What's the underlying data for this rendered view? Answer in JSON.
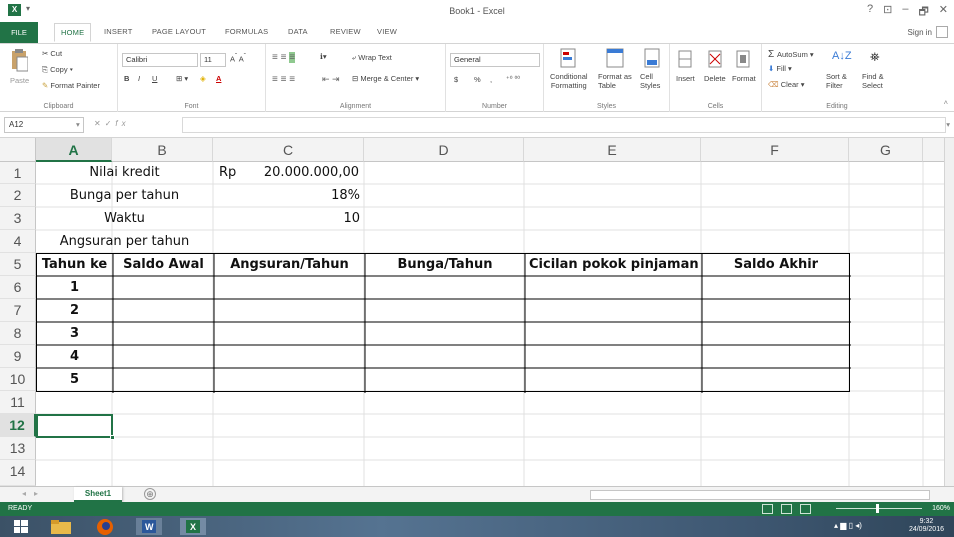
{
  "window": {
    "title": "Book1 - Excel",
    "controls": [
      "?",
      "⊡",
      "–",
      "🗗",
      "✕"
    ]
  },
  "ribbon_tabs": {
    "file": "FILE",
    "tabs": [
      "HOME",
      "INSERT",
      "PAGE LAYOUT",
      "FORMULAS",
      "DATA",
      "REVIEW",
      "VIEW"
    ],
    "active": "HOME",
    "sign_in": "Sign in"
  },
  "ribbon": {
    "clipboard": {
      "paste": "Paste",
      "cut": "Cut",
      "copy": "Copy",
      "format_painter": "Format Painter",
      "label": "Clipboard"
    },
    "font": {
      "name": "Calibri",
      "size": "11",
      "label": "Font",
      "bold": "B",
      "italic": "I",
      "underline": "U"
    },
    "alignment": {
      "wrap_text": "Wrap Text",
      "merge_center": "Merge & Center",
      "label": "Alignment"
    },
    "number": {
      "format": "General",
      "label": "Number",
      "currency": "$",
      "percent": "%",
      "comma": ","
    },
    "styles": {
      "conditional_1": "Conditional",
      "conditional_2": "Formatting",
      "format_table_1": "Format as",
      "format_table_2": "Table",
      "cell_styles_1": "Cell",
      "cell_styles_2": "Styles",
      "label": "Styles"
    },
    "cells": {
      "insert": "Insert",
      "delete": "Delete",
      "format": "Format",
      "label": "Cells"
    },
    "editing": {
      "autosum": "AutoSum",
      "fill": "Fill",
      "clear": "Clear",
      "sort_1": "Sort &",
      "sort_2": "Filter",
      "find_1": "Find &",
      "find_2": "Select",
      "label": "Editing"
    }
  },
  "formula_bar": {
    "name_box": "A12",
    "formula": "",
    "fx": "fx"
  },
  "columns": [
    "A",
    "B",
    "C",
    "D",
    "E",
    "F",
    "G"
  ],
  "selected_column": "A",
  "rows": [
    "1",
    "2",
    "3",
    "4",
    "5",
    "6",
    "7",
    "8",
    "9",
    "10",
    "11",
    "12",
    "13",
    "14"
  ],
  "selected_row": "12",
  "cells": {
    "a1b1": "Nilai kredit",
    "c1_prefix": "Rp",
    "c1_value": "20.000.000,00",
    "a2b2": "Bunga per tahun",
    "c2": "18%",
    "a3b3": "Waktu",
    "c3": "10",
    "a4b4": "Angsuran per tahun",
    "headers": [
      "Tahun ke",
      "Saldo Awal",
      "Angsuran/Tahun",
      "Bunga/Tahun",
      "Cicilan pokok pinjaman",
      "Saldo Akhir"
    ],
    "years": [
      "1",
      "2",
      "3",
      "4",
      "5"
    ]
  },
  "sheets": {
    "tabs": [
      "Sheet1"
    ],
    "active": "Sheet1",
    "add": "⊕"
  },
  "status": {
    "mode": "READY",
    "zoom": "160%"
  },
  "taskbar": {
    "time": "9:32",
    "date": "24/09/2016"
  }
}
